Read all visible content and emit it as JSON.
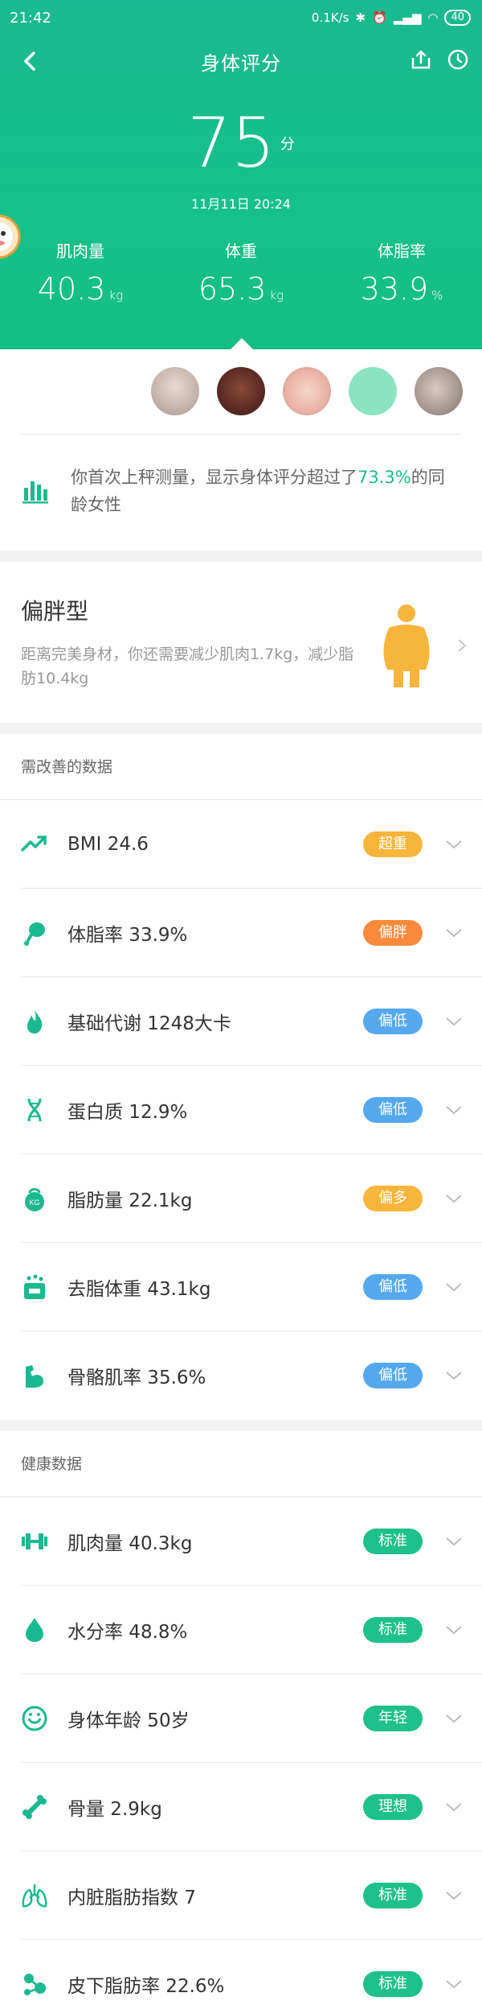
{
  "status_bar": {
    "time": "21:42",
    "speed": "0.1K/s",
    "battery": "40"
  },
  "header": {
    "title": "身体评分"
  },
  "score": {
    "value": "75",
    "unit": "分",
    "datetime": "11月11日 20:24"
  },
  "metrics": [
    {
      "label": "肌肉量",
      "value": "40.3",
      "unit": "kg"
    },
    {
      "label": "体重",
      "value": "65.3",
      "unit": "kg"
    },
    {
      "label": "体脂率",
      "value": "33.9",
      "unit": "%"
    }
  ],
  "summary": {
    "text_before": "你首次上秤测量，显示身体评分超过了",
    "highlight": "73.3%",
    "text_after": "的同龄女性"
  },
  "body_type": {
    "title": "偏胖型",
    "description": "距离完美身材，你还需要减少肌肉1.7kg，减少脂肪10.4kg"
  },
  "improve_section": {
    "title": "需改善的数据",
    "items": [
      {
        "label": "BMI 24.6",
        "badge": "超重",
        "badge_color": "#f7b53b",
        "icon": "trend-up-icon"
      },
      {
        "label": "体脂率 33.9%",
        "badge": "偏胖",
        "badge_color": "#f98a3c",
        "icon": "drumstick-icon"
      },
      {
        "label": "基础代谢 1248大卡",
        "badge": "偏低",
        "badge_color": "#55a8ee",
        "icon": "flame-icon"
      },
      {
        "label": "蛋白质 12.9%",
        "badge": "偏低",
        "badge_color": "#55a8ee",
        "icon": "dna-icon"
      },
      {
        "label": "脂肪量 22.1kg",
        "badge": "偏多",
        "badge_color": "#f7b53b",
        "icon": "kettlebell-icon"
      },
      {
        "label": "去脂体重 43.1kg",
        "badge": "偏低",
        "badge_color": "#55a8ee",
        "icon": "lean-weight-icon"
      },
      {
        "label": "骨骼肌率 35.6%",
        "badge": "偏低",
        "badge_color": "#55a8ee",
        "icon": "bicep-icon"
      }
    ]
  },
  "health_section": {
    "title": "健康数据",
    "items": [
      {
        "label": "肌肉量 40.3kg",
        "badge": "标准",
        "badge_color": "#1fc08b",
        "icon": "dumbbell-icon"
      },
      {
        "label": "水分率 48.8%",
        "badge": "标准",
        "badge_color": "#1fc08b",
        "icon": "water-drop-icon"
      },
      {
        "label": "身体年龄 50岁",
        "badge": "年轻",
        "badge_color": "#1fc08b",
        "icon": "smile-icon"
      },
      {
        "label": "骨量 2.9kg",
        "badge": "理想",
        "badge_color": "#1fc08b",
        "icon": "bone-icon"
      },
      {
        "label": "内脏脂肪指数 7",
        "badge": "标准",
        "badge_color": "#1fc08b",
        "icon": "lungs-icon"
      },
      {
        "label": "皮下脂肪率 22.6%",
        "badge": "标准",
        "badge_color": "#1fc08b",
        "icon": "molecule-icon"
      }
    ]
  },
  "colors": {
    "accent": "#1bb98f"
  }
}
